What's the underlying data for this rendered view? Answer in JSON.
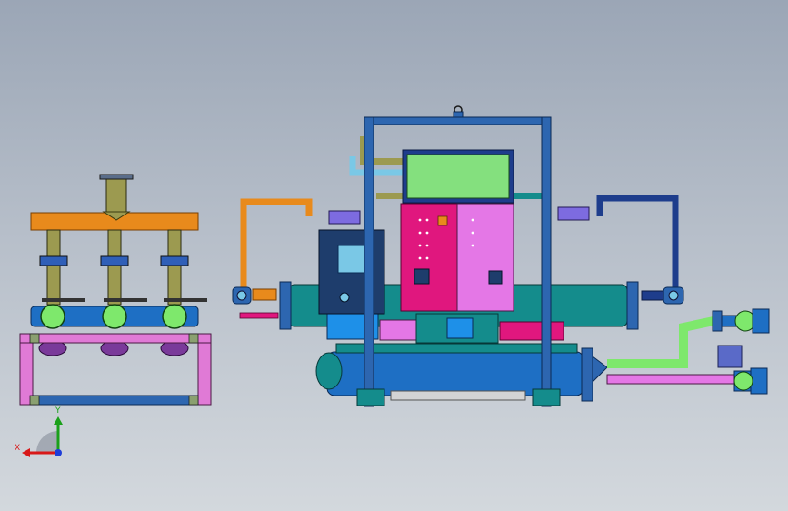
{
  "triad": {
    "x_label": "X",
    "y_label": "Y"
  },
  "colors": {
    "background_top": "#9ba6b6",
    "background_bottom": "#d3d8dd",
    "frame_blue": "#2d66b0",
    "pipe_blue": "#1e6fc4",
    "teal_shell": "#148c8c",
    "orange_pipe": "#e88a1c",
    "magenta_panel": "#e0177e",
    "violet_panel": "#e477e6",
    "screen_green": "#84e07e",
    "pink_frame": "#e07ad6",
    "navy_pipe": "#1e3d8c",
    "lime_pipe": "#7ee86c",
    "olive_pipe": "#9c9a50"
  }
}
